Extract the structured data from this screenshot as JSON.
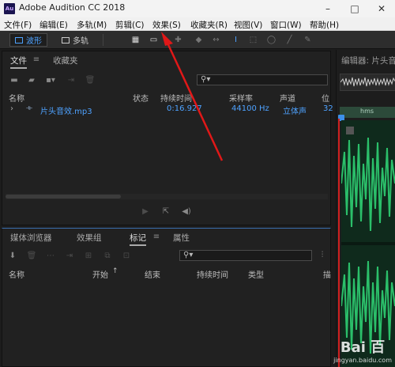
{
  "window": {
    "title": "Adobe Audition CC 2018",
    "app_icon": "Au",
    "controls": {
      "minimize": "–",
      "maximize": "□",
      "close": "✕"
    }
  },
  "menu": [
    "文件(F)",
    "编辑(E)",
    "多轨(M)",
    "剪辑(C)",
    "效果(S)",
    "收藏夹(R)",
    "视图(V)",
    "窗口(W)",
    "帮助(H)"
  ],
  "toolbar": {
    "waveform_label": "波形",
    "multitrack_label": "多轨",
    "tools": [
      "spectral-frequency-icon",
      "waveform-view-icon",
      "move-tool-icon",
      "razor-tool-icon",
      "slip-tool-icon",
      "time-selection-tool-icon",
      "marquee-tool-icon",
      "lasso-tool-icon",
      "brush-tool-icon",
      "spot-healing-icon"
    ]
  },
  "files_panel": {
    "tabs": [
      "文件",
      "收藏夹"
    ],
    "search_placeholder": "",
    "columns": [
      "名称",
      "状态",
      "持续时间",
      "采样率",
      "声道",
      "位"
    ],
    "rows": [
      {
        "name": "片头音效.mp3",
        "status": "",
        "duration": "0:16.927",
        "sample_rate": "44100 Hz",
        "channels": "立体声",
        "bit": "32"
      }
    ]
  },
  "markers_panel": {
    "tabs": [
      "媒体浏览器",
      "效果组",
      "标记",
      "属性"
    ],
    "active_tab": "标记",
    "columns": [
      "名称",
      "开始",
      "结束",
      "持续时间",
      "类型",
      "描"
    ]
  },
  "editor": {
    "title": "编辑器: 片头音效",
    "ruler_unit": "hms"
  },
  "watermark": {
    "logo": "Bai 百",
    "sub": "jingyan.baidu.com"
  },
  "colors": {
    "accent": "#4ea2ff",
    "annotation_arrow": "#e01818",
    "waveform": "#2bbf6a"
  }
}
